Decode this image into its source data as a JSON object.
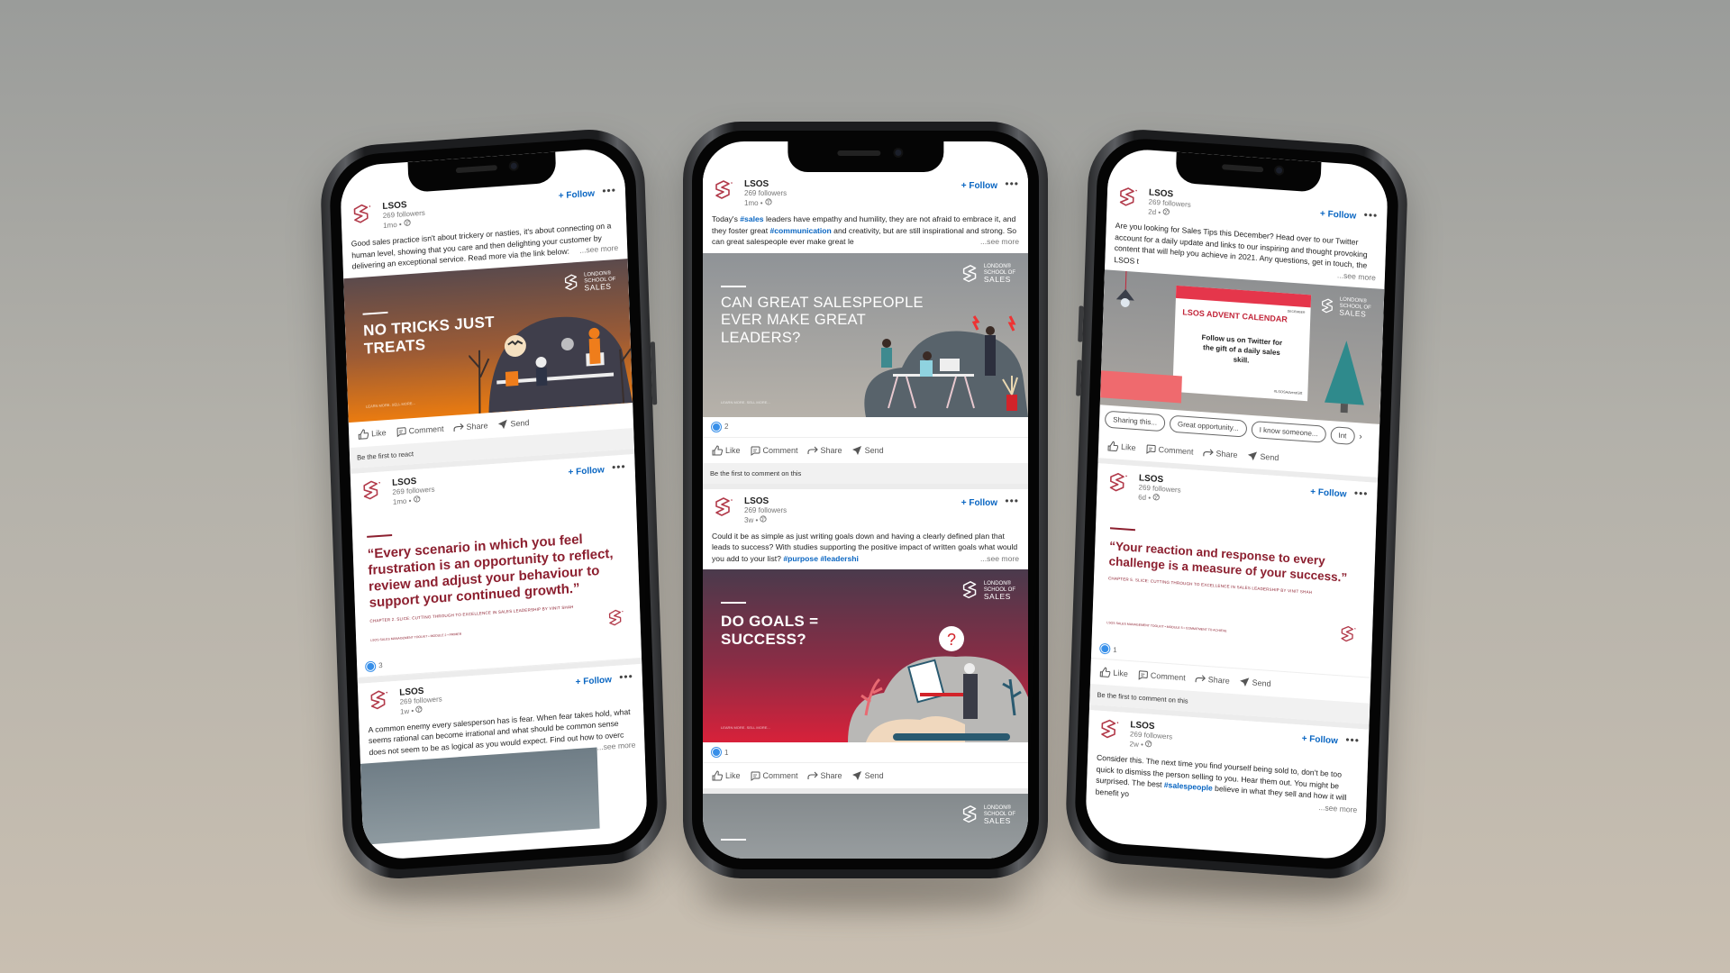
{
  "brand": {
    "name": "LSOS",
    "followers": "269 followers",
    "follow_label": "+ Follow",
    "more_label": "•••",
    "see_more": "...see more",
    "wordmark": {
      "line1": "LONDON®",
      "line2": "SCHOOL OF",
      "line3": "SALES"
    },
    "banner_small": "LEARN MORE. SELL MORE..."
  },
  "actions": {
    "like": "Like",
    "comment": "Comment",
    "share": "Share",
    "send": "Send"
  },
  "colors": {
    "accent": "#0a66c2",
    "quote": "#8c1f2f",
    "brand_red": "#c2263a"
  },
  "phones": [
    {
      "posts": [
        {
          "time": "1mo •",
          "text": "Good sales practice isn't about trickery or nasties, it's about connecting on a human level, showing that you care and then delighting your customer by delivering an exceptional service. Read more via the link below:",
          "banner_title": "NO TRICKS JUST TREATS",
          "footer_note": "Be the first to react"
        },
        {
          "time": "1mo •",
          "quote": "“Every scenario in which you feel frustration is an opportunity to reflect, review and adjust your behaviour to support your continued growth.”",
          "quote_source": "CHAPTER 2. SLICE: CUTTING THROUGH TO EXCELLENCE IN SALES LEADERSHIP BY VINIT SHAH",
          "quote_footer": "LSOS SALES MANAGEMENT TOOLKIT • MODULE 2 • PRIMER",
          "reactions": "3"
        },
        {
          "time": "1w •",
          "text": "A common enemy every salesperson has is fear. When fear takes hold, what seems rational can become irrational and what should be common sense does not seem to be as logical as you would expect. Find out how to overc"
        }
      ]
    },
    {
      "posts": [
        {
          "time": "1mo •",
          "text_parts": [
            "Today's ",
            "#sales",
            " leaders have empathy and humility, they are not afraid to embrace it, and they foster great ",
            "#communication",
            " and creativity, but are still inspirational and strong. So can great salespeople ever make great le"
          ],
          "banner_title": "CAN GREAT SALESPEOPLE EVER MAKE GREAT LEADERS?",
          "reactions": "2",
          "footer_note": "Be the first to comment on this"
        },
        {
          "time": "3w •",
          "text_parts": [
            "Could it be as simple as just writing goals down and having a clearly defined plan that leads to success? With studies supporting the positive impact of written goals what would you add to your list? ",
            "#purpose #leadershi"
          ],
          "banner_title": "DO GOALS = SUCCESS?",
          "reactions": "1"
        }
      ]
    },
    {
      "posts": [
        {
          "time": "2d •",
          "text": "Are you looking for Sales Tips this December? Head over to our Twitter account for a daily update and links to our inspiring and thought provoking content that will help you achieve in 2021. Any questions, get in touch, the LSOS t",
          "calendar_title": "LSOS ADVENT CALENDAR",
          "calendar_month": "DECEMBER",
          "calendar_body": "Follow us on Twitter for the gift of a daily sales skill.",
          "calendar_tag": "#LSOSAdventGift",
          "chips": [
            "Sharing this...",
            "Great opportunity...",
            "I know someone...",
            "Int"
          ]
        },
        {
          "time": "6d •",
          "quote": "“Your reaction and response to every challenge is a measure of your success.”",
          "quote_source": "CHAPTER 5. SLICE: CUTTING THROUGH TO EXCELLENCE IN SALES LEADERSHIP BY VINIT SHAH",
          "quote_footer": "LSOS SALES MANAGEMENT TOOLKIT • MODULE 5 • COMMITMENT TO ACHIEVE",
          "reactions": "1",
          "footer_note": "Be the first to comment on this"
        },
        {
          "time": "2w •",
          "text_parts": [
            "Consider this. The next time you find yourself being sold to, don't be too quick to dismiss the person selling to you. Hear them out. You might be surprised. The best ",
            "#salespeople",
            " believe in what they sell and how it will benefit yo"
          ]
        }
      ]
    }
  ]
}
